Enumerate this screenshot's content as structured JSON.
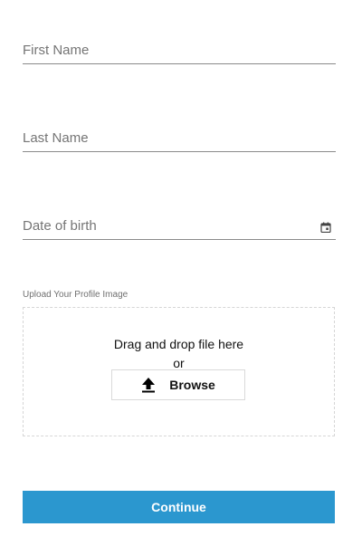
{
  "form": {
    "first_name": {
      "placeholder": "First Name",
      "value": ""
    },
    "last_name": {
      "placeholder": "Last Name",
      "value": ""
    },
    "date_of_birth": {
      "placeholder": "Date of birth",
      "value": "",
      "icon": "calendar-icon"
    }
  },
  "upload": {
    "label": "Upload Your Profile Image",
    "drop_text": "Drag and drop file here",
    "or_text": "or",
    "browse_label": "Browse",
    "browse_icon": "upload-icon"
  },
  "actions": {
    "continue_label": "Continue"
  },
  "colors": {
    "accent": "#2b97cf",
    "underline": "#8a8a8a",
    "dropzone_border": "#d6d6d6"
  }
}
